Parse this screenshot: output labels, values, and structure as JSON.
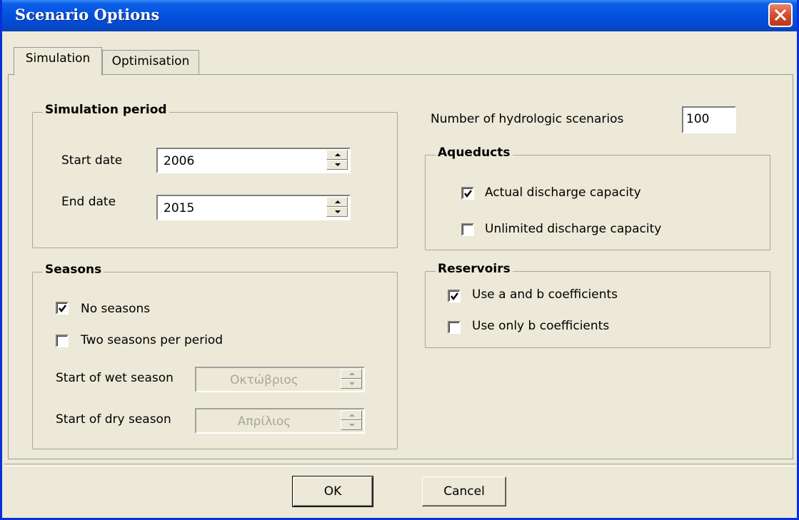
{
  "window": {
    "title": "Scenario Options"
  },
  "tabs": [
    {
      "label": "Simulation",
      "active": true
    },
    {
      "label": "Optimisation",
      "active": false
    }
  ],
  "simulation_period": {
    "legend": "Simulation period",
    "start_label": "Start date",
    "start_value": "2006",
    "end_label": "End date",
    "end_value": "2015"
  },
  "seasons": {
    "legend": "Seasons",
    "no_seasons_label": "No seasons",
    "no_seasons_checked": true,
    "two_seasons_label": "Two seasons per period",
    "two_seasons_checked": false,
    "wet_label": "Start of wet season",
    "wet_value": "Οκτώβριος",
    "dry_label": "Start of dry season",
    "dry_value": "Απρίλιος"
  },
  "hydrologic": {
    "label": "Number of hydrologic scenarios",
    "value": "100"
  },
  "aqueducts": {
    "legend": "Aqueducts",
    "actual_label": "Actual discharge capacity",
    "actual_checked": true,
    "unlimited_label": "Unlimited discharge capacity",
    "unlimited_checked": false
  },
  "reservoirs": {
    "legend": "Reservoirs",
    "ab_label": "Use a and b coefficients",
    "ab_checked": true,
    "b_label": "Use only b coefficients",
    "b_checked": false
  },
  "buttons": {
    "ok": "OK",
    "cancel": "Cancel"
  },
  "colors": {
    "titlebar": "#0553e0",
    "face": "#ece9d8",
    "close": "#d34e2f"
  }
}
